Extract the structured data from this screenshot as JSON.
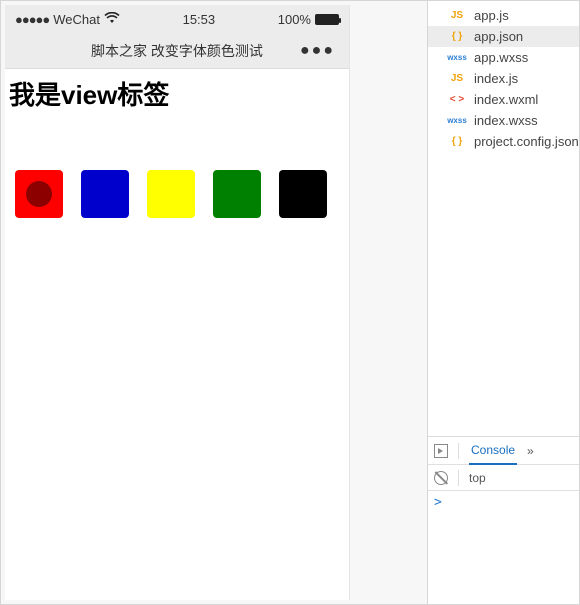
{
  "statusbar": {
    "signal": "●●●●●",
    "carrier": "WeChat",
    "time": "15:53",
    "battery_pct": "100%"
  },
  "navbar": {
    "title": "脚本之家 改变字体颜色测试",
    "more": "●●●"
  },
  "page": {
    "view_text": "我是view标签"
  },
  "swatches": [
    {
      "color": "#ff0000",
      "selected": true
    },
    {
      "color": "#0000cc",
      "selected": false
    },
    {
      "color": "#ffff00",
      "selected": false
    },
    {
      "color": "#008000",
      "selected": false
    },
    {
      "color": "#000000",
      "selected": false
    }
  ],
  "files": [
    {
      "icon": "JS",
      "icon_class": "ic-js",
      "name": "app.js",
      "selected": false
    },
    {
      "icon": "{ }",
      "icon_class": "ic-json",
      "name": "app.json",
      "selected": true
    },
    {
      "icon": "wxss",
      "icon_class": "ic-wxss",
      "name": "app.wxss",
      "selected": false
    },
    {
      "icon": "JS",
      "icon_class": "ic-js",
      "name": "index.js",
      "selected": false
    },
    {
      "icon": "< >",
      "icon_class": "ic-wxml",
      "name": "index.wxml",
      "selected": false
    },
    {
      "icon": "wxss",
      "icon_class": "ic-wxss",
      "name": "index.wxss",
      "selected": false
    },
    {
      "icon": "{ }",
      "icon_class": "ic-json",
      "name": "project.config.json",
      "selected": false
    }
  ],
  "devtools": {
    "tab": "Console",
    "more": "»",
    "ctx": "top",
    "prompt": ">"
  }
}
